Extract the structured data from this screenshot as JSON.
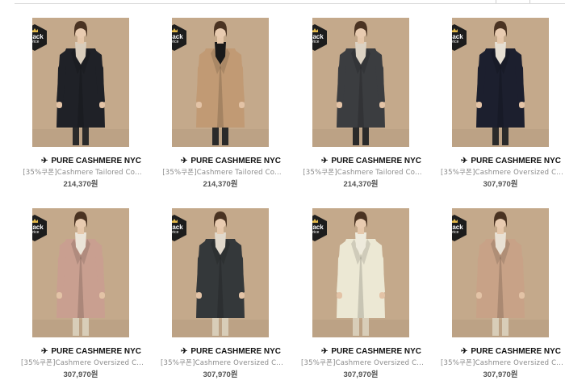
{
  "products": [
    {
      "brand": "PURE CASHMERE NYC",
      "name": "[35%쿠폰]Cashmere Tailored Co...",
      "price": "214,370원",
      "badge_line1": "Black",
      "badge_line2": "price",
      "coat_color": "#1f2127",
      "scarf_color": "#d9cdbc",
      "bg": "#c4a98b",
      "brand_icon": "plane-icon"
    },
    {
      "brand": "PURE CASHMERE NYC",
      "name": "[35%쿠폰]Cashmere Tailored Co...",
      "price": "214,370원",
      "badge_line1": "Black",
      "badge_line2": "price",
      "coat_color": "#c19a74",
      "scarf_color": "#1a1a1a",
      "bg": "#c4a98b",
      "brand_icon": "plane-icon"
    },
    {
      "brand": "PURE CASHMERE NYC",
      "name": "[35%쿠폰]Cashmere Tailored Co...",
      "price": "214,370원",
      "badge_line1": "Black",
      "badge_line2": "price",
      "coat_color": "#3b3d40",
      "scarf_color": "#dcd2c3",
      "bg": "#c4a98b",
      "brand_icon": "plane-icon"
    },
    {
      "brand": "PURE CASHMERE NYC",
      "name": "[35%쿠폰]Cashmere Oversized C...",
      "price": "307,970원",
      "badge_line1": "Black",
      "badge_line2": "price",
      "coat_color": "#1c1f2e",
      "scarf_color": "#e6dfd3",
      "bg": "#c4a98b",
      "brand_icon": "plane-icon"
    },
    {
      "brand": "PURE CASHMERE NYC",
      "name": "[35%쿠폰]Cashmere Oversized C...",
      "price": "307,970원",
      "badge_line1": "Black",
      "badge_line2": "price",
      "coat_color": "#c99f90",
      "scarf_color": "#ebe4d8",
      "bg": "#c4a98b",
      "brand_icon": "plane-icon"
    },
    {
      "brand": "PURE CASHMERE NYC",
      "name": "[35%쿠폰]Cashmere Oversized C...",
      "price": "307,970원",
      "badge_line1": "Black",
      "badge_line2": "price",
      "coat_color": "#34383a",
      "scarf_color": "#e1d9cc",
      "bg": "#c4a98b",
      "brand_icon": "plane-icon"
    },
    {
      "brand": "PURE CASHMERE NYC",
      "name": "[35%쿠폰]Cashmere Oversized C...",
      "price": "307,970원",
      "badge_line1": "Black",
      "badge_line2": "price",
      "coat_color": "#ece8d4",
      "scarf_color": "#eeeadc",
      "bg": "#c4a98b",
      "brand_icon": "plane-icon"
    },
    {
      "brand": "PURE CASHMERE NYC",
      "name": "[35%쿠폰]Cashmere Oversized C...",
      "price": "307,970원",
      "badge_line1": "Black",
      "badge_line2": "price",
      "coat_color": "#c8a287",
      "scarf_color": "#e9e1d4",
      "bg": "#c4a98b",
      "brand_icon": "plane-icon"
    }
  ]
}
